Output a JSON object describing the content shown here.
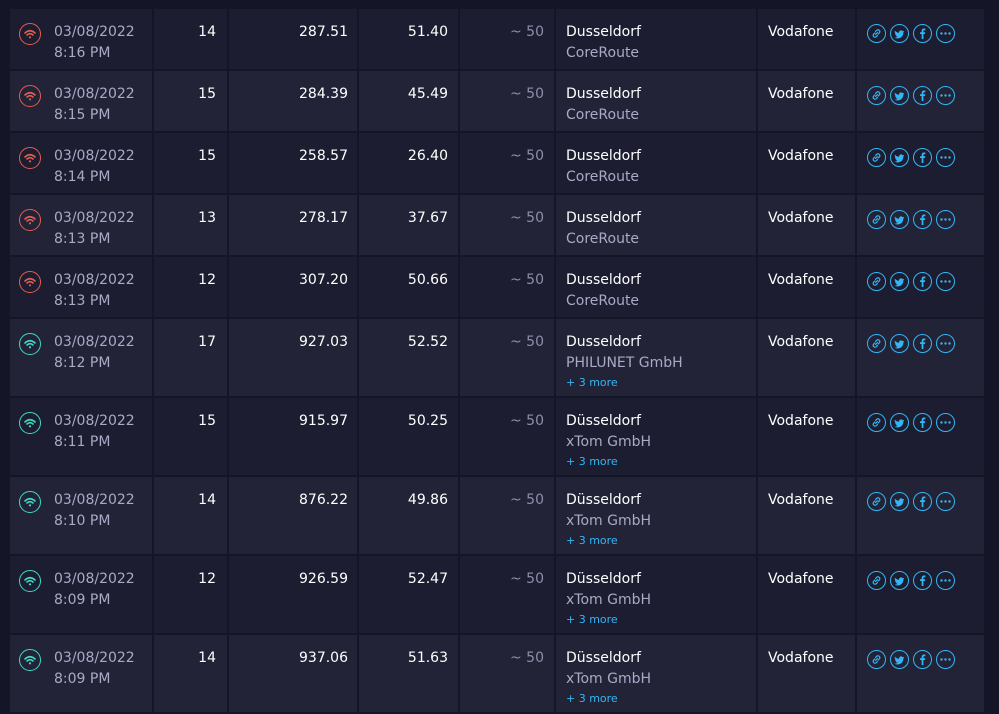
{
  "colors": {
    "background": "#141526",
    "row_odd": "#1c1d30",
    "row_even": "#222337",
    "slow_connection": "#e35e4f",
    "fast_connection": "#3ed9c8",
    "accent": "#33b6f5"
  },
  "rows": [
    {
      "date": "03/08/2022",
      "time": "8:16 PM",
      "ping": "14",
      "download": "287.51",
      "upload": "51.40",
      "sim": "~ 50",
      "server_city": "Dusseldorf",
      "server_host": "CoreRoute",
      "more": "",
      "provider": "Vodafone",
      "speed_class": "slow"
    },
    {
      "date": "03/08/2022",
      "time": "8:15 PM",
      "ping": "15",
      "download": "284.39",
      "upload": "45.49",
      "sim": "~ 50",
      "server_city": "Dusseldorf",
      "server_host": "CoreRoute",
      "more": "",
      "provider": "Vodafone",
      "speed_class": "slow"
    },
    {
      "date": "03/08/2022",
      "time": "8:14 PM",
      "ping": "15",
      "download": "258.57",
      "upload": "26.40",
      "sim": "~ 50",
      "server_city": "Dusseldorf",
      "server_host": "CoreRoute",
      "more": "",
      "provider": "Vodafone",
      "speed_class": "slow"
    },
    {
      "date": "03/08/2022",
      "time": "8:13 PM",
      "ping": "13",
      "download": "278.17",
      "upload": "37.67",
      "sim": "~ 50",
      "server_city": "Dusseldorf",
      "server_host": "CoreRoute",
      "more": "",
      "provider": "Vodafone",
      "speed_class": "slow"
    },
    {
      "date": "03/08/2022",
      "time": "8:13 PM",
      "ping": "12",
      "download": "307.20",
      "upload": "50.66",
      "sim": "~ 50",
      "server_city": "Dusseldorf",
      "server_host": "CoreRoute",
      "more": "",
      "provider": "Vodafone",
      "speed_class": "slow"
    },
    {
      "date": "03/08/2022",
      "time": "8:12 PM",
      "ping": "17",
      "download": "927.03",
      "upload": "52.52",
      "sim": "~ 50",
      "server_city": "Dusseldorf",
      "server_host": "PHILUNET GmbH",
      "more": "+ 3 more",
      "provider": "Vodafone",
      "speed_class": "fast"
    },
    {
      "date": "03/08/2022",
      "time": "8:11 PM",
      "ping": "15",
      "download": "915.97",
      "upload": "50.25",
      "sim": "~ 50",
      "server_city": "Düsseldorf",
      "server_host": "xTom GmbH",
      "more": "+ 3 more",
      "provider": "Vodafone",
      "speed_class": "fast"
    },
    {
      "date": "03/08/2022",
      "time": "8:10 PM",
      "ping": "14",
      "download": "876.22",
      "upload": "49.86",
      "sim": "~ 50",
      "server_city": "Düsseldorf",
      "server_host": "xTom GmbH",
      "more": "+ 3 more",
      "provider": "Vodafone",
      "speed_class": "fast"
    },
    {
      "date": "03/08/2022",
      "time": "8:09 PM",
      "ping": "12",
      "download": "926.59",
      "upload": "52.47",
      "sim": "~ 50",
      "server_city": "Düsseldorf",
      "server_host": "xTom GmbH",
      "more": "+ 3 more",
      "provider": "Vodafone",
      "speed_class": "fast"
    },
    {
      "date": "03/08/2022",
      "time": "8:09 PM",
      "ping": "14",
      "download": "937.06",
      "upload": "51.63",
      "sim": "~ 50",
      "server_city": "Düsseldorf",
      "server_host": "xTom GmbH",
      "more": "+ 3 more",
      "provider": "Vodafone",
      "speed_class": "fast"
    }
  ],
  "share_icons": [
    "link-icon",
    "twitter-icon",
    "facebook-icon",
    "more-options-icon"
  ]
}
